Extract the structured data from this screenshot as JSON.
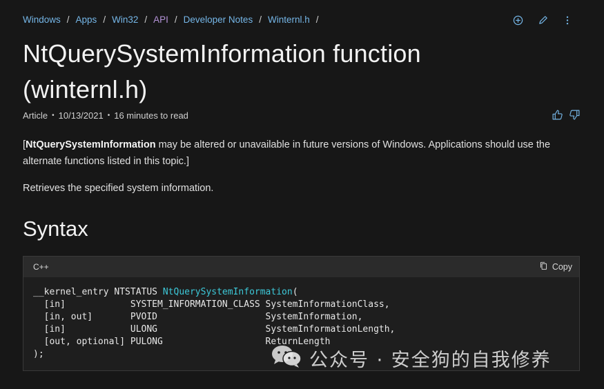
{
  "breadcrumb": [
    {
      "label": "Windows",
      "visited": false
    },
    {
      "label": "Apps",
      "visited": false
    },
    {
      "label": "Win32",
      "visited": false
    },
    {
      "label": "API",
      "visited": true
    },
    {
      "label": "Developer Notes",
      "visited": false
    },
    {
      "label": "Winternl.h",
      "visited": false
    }
  ],
  "breadcrumb_sep": "/",
  "title": "NtQuerySystemInformation function (winternl.h)",
  "meta": {
    "type": "Article",
    "date": "10/13/2021",
    "read_time": "16 minutes to read"
  },
  "note": {
    "bold": "NtQuerySystemInformation",
    "rest": " may be altered or unavailable in future versions of Windows. Applications should use the alternate functions listed in this topic.]",
    "open": "["
  },
  "description": "Retrieves the specified system information.",
  "syntax_heading": "Syntax",
  "code": {
    "language": "C++",
    "copy_label": "Copy",
    "prefix": "__kernel_entry NTSTATUS ",
    "function_name": "NtQuerySystemInformation",
    "suffix": "(",
    "lines": [
      "  [in]            SYSTEM_INFORMATION_CLASS SystemInformationClass,",
      "  [in, out]       PVOID                    SystemInformation,",
      "  [in]            ULONG                    SystemInformationLength,",
      "  [out, optional] PULONG                   ReturnLength",
      ");"
    ]
  },
  "watermark": "公众号 · 安全狗的自我修养",
  "colors": {
    "link": "#75b6e7",
    "visited": "#b493d8",
    "function": "#3dc9d9",
    "background": "#171717"
  },
  "icons": {
    "top": [
      "add-collection-icon",
      "edit-pencil-icon",
      "more-options-icon"
    ],
    "feedback": [
      "thumbs-up-icon",
      "thumbs-down-icon"
    ],
    "copy": "copy-icon",
    "watermark": "wechat-icon"
  }
}
